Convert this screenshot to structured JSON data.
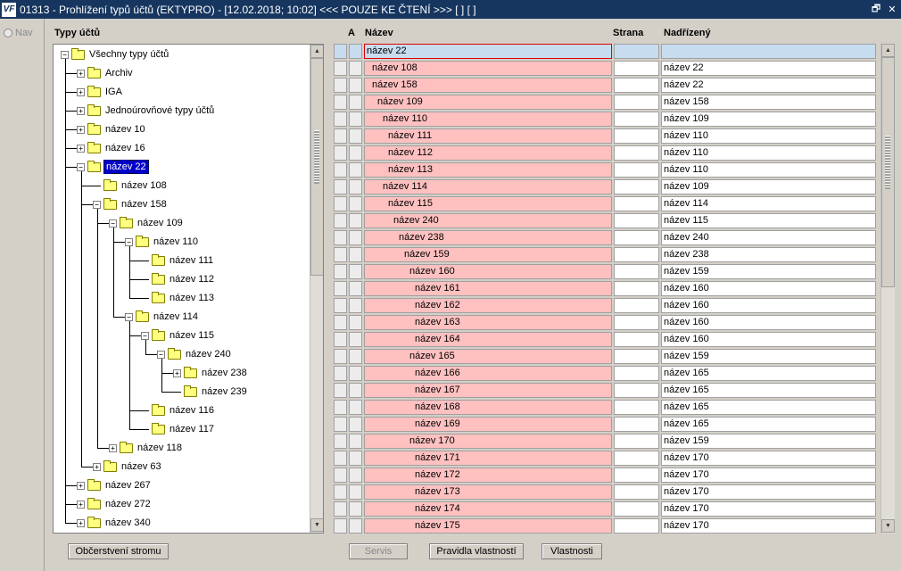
{
  "window": {
    "logo": "VF",
    "title": "01313 - Prohlížení typů účtů (EKTYPRO) - [12.02.2018; 10:02] <<< POUZE KE ČTENÍ >>> [ ] [ ]",
    "restore_glyph": "🗗",
    "close_glyph": "✕"
  },
  "nav": {
    "label": "Nav"
  },
  "tree": {
    "label": "Typy účtů",
    "nodes": [
      {
        "label": "Všechny typy účtů",
        "depth": 0,
        "exp": "minus",
        "open": true
      },
      {
        "label": "Archiv",
        "depth": 1,
        "exp": "plus"
      },
      {
        "label": "IGA",
        "depth": 1,
        "exp": "plus"
      },
      {
        "label": "Jednoúrovňové typy účtů",
        "depth": 1,
        "exp": "plus"
      },
      {
        "label": "název 10",
        "depth": 1,
        "exp": "plus"
      },
      {
        "label": "název 16",
        "depth": 1,
        "exp": "plus"
      },
      {
        "label": "název 22",
        "depth": 1,
        "exp": "minus",
        "open": true,
        "selected": true
      },
      {
        "label": "název 108",
        "depth": 2,
        "exp": "none"
      },
      {
        "label": "název 158",
        "depth": 2,
        "exp": "minus",
        "open": true
      },
      {
        "label": "název 109",
        "depth": 3,
        "exp": "minus",
        "open": true
      },
      {
        "label": "název 110",
        "depth": 4,
        "exp": "minus",
        "open": true
      },
      {
        "label": "název 111",
        "depth": 5,
        "exp": "none"
      },
      {
        "label": "název 112",
        "depth": 5,
        "exp": "none"
      },
      {
        "label": "název 113",
        "depth": 5,
        "exp": "none"
      },
      {
        "label": "název 114",
        "depth": 4,
        "exp": "minus",
        "open": true
      },
      {
        "label": "název 115",
        "depth": 5,
        "exp": "minus",
        "open": true
      },
      {
        "label": "název 240",
        "depth": 6,
        "exp": "minus",
        "open": true
      },
      {
        "label": "název 238",
        "depth": 7,
        "exp": "plus"
      },
      {
        "label": "název 239",
        "depth": 7,
        "exp": "none"
      },
      {
        "label": "název 116",
        "depth": 5,
        "exp": "none"
      },
      {
        "label": "název 117",
        "depth": 5,
        "exp": "none"
      },
      {
        "label": "název 118",
        "depth": 3,
        "exp": "plus"
      },
      {
        "label": "název 63",
        "depth": 2,
        "exp": "plus"
      },
      {
        "label": "název 267",
        "depth": 1,
        "exp": "plus"
      },
      {
        "label": "název 272",
        "depth": 1,
        "exp": "plus"
      },
      {
        "label": "název 340",
        "depth": 1,
        "exp": "plus"
      }
    ]
  },
  "grid": {
    "headers": {
      "a": "A",
      "nazev": "Název",
      "strana": "Strana",
      "nadrizeny": "Nadřízený"
    },
    "rows": [
      {
        "nazev": "název 22",
        "indent": 0,
        "strana": "",
        "nadrizeny": ""
      },
      {
        "nazev": "název 108",
        "indent": 1,
        "strana": "",
        "nadrizeny": "název 22"
      },
      {
        "nazev": "název 158",
        "indent": 1,
        "strana": "",
        "nadrizeny": "název 22"
      },
      {
        "nazev": "název 109",
        "indent": 2,
        "strana": "",
        "nadrizeny": "název 158"
      },
      {
        "nazev": "název 110",
        "indent": 3,
        "strana": "",
        "nadrizeny": "název 109"
      },
      {
        "nazev": "název 111",
        "indent": 4,
        "strana": "",
        "nadrizeny": "název 110"
      },
      {
        "nazev": "název 112",
        "indent": 4,
        "strana": "",
        "nadrizeny": "název 110"
      },
      {
        "nazev": "název 113",
        "indent": 4,
        "strana": "",
        "nadrizeny": "název 110"
      },
      {
        "nazev": "název 114",
        "indent": 3,
        "strana": "",
        "nadrizeny": "název 109"
      },
      {
        "nazev": "název 115",
        "indent": 4,
        "strana": "",
        "nadrizeny": "název 114"
      },
      {
        "nazev": "název 240",
        "indent": 5,
        "strana": "",
        "nadrizeny": "název 115"
      },
      {
        "nazev": "název 238",
        "indent": 6,
        "strana": "",
        "nadrizeny": "název 240"
      },
      {
        "nazev": "název 159",
        "indent": 7,
        "strana": "",
        "nadrizeny": "název 238"
      },
      {
        "nazev": "název 160",
        "indent": 8,
        "strana": "",
        "nadrizeny": "název 159"
      },
      {
        "nazev": "název 161",
        "indent": 9,
        "strana": "",
        "nadrizeny": "název 160"
      },
      {
        "nazev": "název 162",
        "indent": 9,
        "strana": "",
        "nadrizeny": "název 160"
      },
      {
        "nazev": "název 163",
        "indent": 9,
        "strana": "",
        "nadrizeny": "název 160"
      },
      {
        "nazev": "název 164",
        "indent": 9,
        "strana": "",
        "nadrizeny": "název 160"
      },
      {
        "nazev": "název 165",
        "indent": 8,
        "strana": "",
        "nadrizeny": "název 159"
      },
      {
        "nazev": "název 166",
        "indent": 9,
        "strana": "",
        "nadrizeny": "název 165"
      },
      {
        "nazev": "název 167",
        "indent": 9,
        "strana": "",
        "nadrizeny": "název 165"
      },
      {
        "nazev": "název 168",
        "indent": 9,
        "strana": "",
        "nadrizeny": "název 165"
      },
      {
        "nazev": "název 169",
        "indent": 9,
        "strana": "",
        "nadrizeny": "název 165"
      },
      {
        "nazev": "název 170",
        "indent": 8,
        "strana": "",
        "nadrizeny": "název 159"
      },
      {
        "nazev": "název 171",
        "indent": 9,
        "strana": "",
        "nadrizeny": "název 170"
      },
      {
        "nazev": "název 172",
        "indent": 9,
        "strana": "",
        "nadrizeny": "název 170"
      },
      {
        "nazev": "název 173",
        "indent": 9,
        "strana": "",
        "nadrizeny": "název 170"
      },
      {
        "nazev": "název 174",
        "indent": 9,
        "strana": "",
        "nadrizeny": "název 170"
      },
      {
        "nazev": "název 175",
        "indent": 9,
        "strana": "",
        "nadrizeny": "název 170"
      }
    ]
  },
  "buttons": {
    "refresh": "Občerstvení stromu",
    "servis": "Servis",
    "rules": "Pravidla vlastností",
    "props": "Vlastnosti"
  },
  "colors": {
    "title_bg": "#16365f",
    "row_pink": "#ffc0c0",
    "selection": "#0000c8",
    "active_row": "#c8dcf0"
  }
}
